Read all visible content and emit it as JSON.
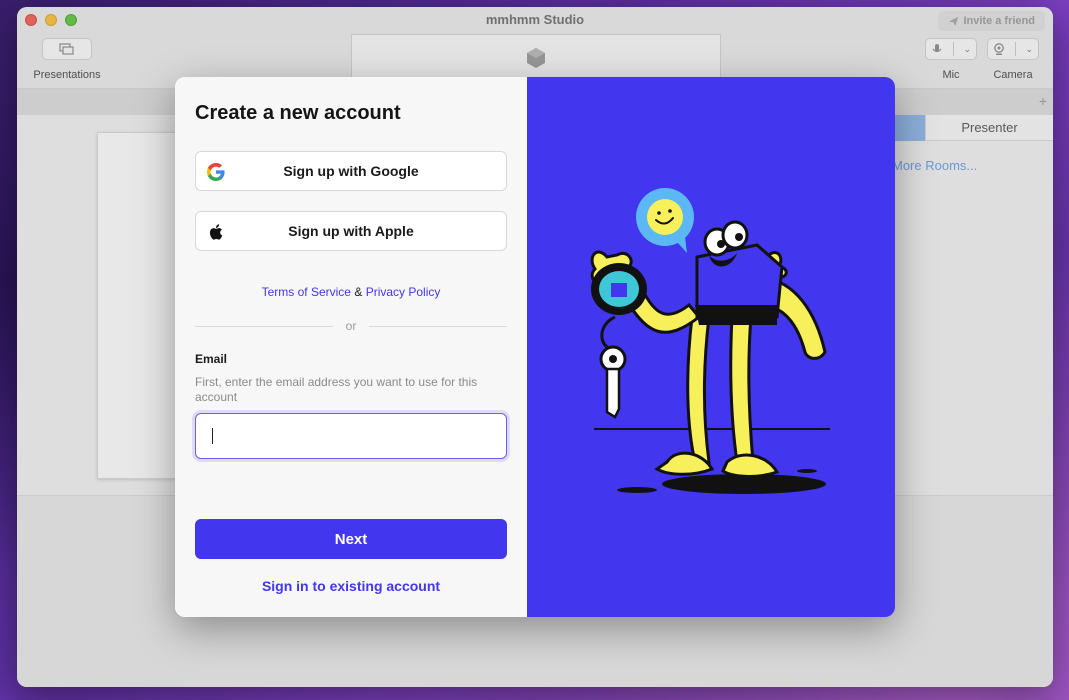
{
  "window": {
    "title": "mmhmm Studio",
    "invite_label": "Invite a friend"
  },
  "toolbar": {
    "presentations_label": "Presentations",
    "mic_label": "Mic",
    "camera_label": "Camera"
  },
  "rooms": {
    "presenter_tab": "Presenter",
    "more_rooms": "More Rooms..."
  },
  "modal": {
    "title": "Create a new account",
    "google_button": "Sign up with Google",
    "apple_button": "Sign up with Apple",
    "terms_link": "Terms of Service",
    "legal_and": "&",
    "privacy_link": "Privacy Policy",
    "divider_text": "or",
    "email_label": "Email",
    "email_help": "First, enter the email address you want to use for this account",
    "email_value": "",
    "next_button": "Next",
    "signin_link": "Sign in to existing account"
  },
  "colors": {
    "accent": "#4236ee",
    "illustration_yellow": "#f8f05a",
    "bubble_blue": "#5bb8f5"
  },
  "icons": {
    "google": "google-g-icon",
    "apple": "apple-logo-icon",
    "invite": "paper-plane-icon",
    "presentations": "presentations-icon",
    "mic": "microphone-icon",
    "camera": "webcam-icon"
  }
}
